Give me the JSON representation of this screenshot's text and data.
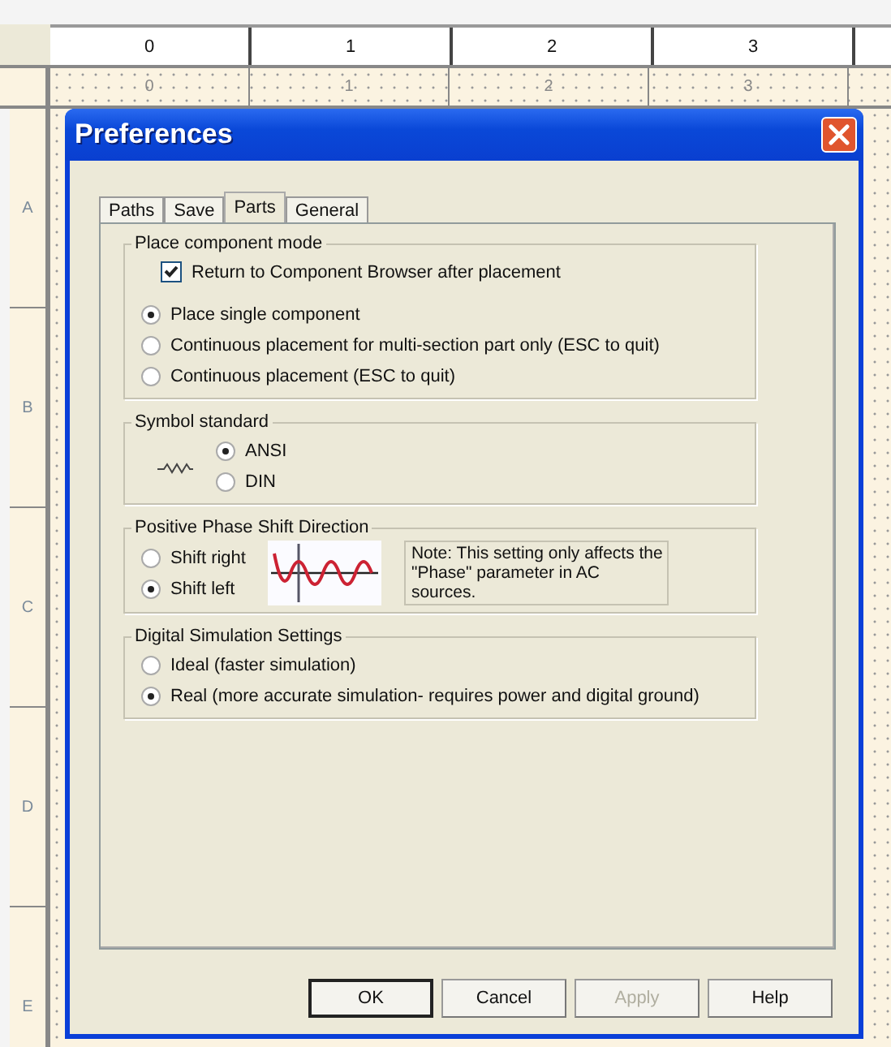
{
  "top_ruler": {
    "labels": [
      "0",
      "1",
      "2",
      "3"
    ]
  },
  "sheet_border": {
    "column_labels": [
      "0",
      "1",
      "2",
      "3"
    ],
    "row_labels": [
      "A",
      "B",
      "C",
      "D",
      "E"
    ]
  },
  "dialog": {
    "title": "Preferences",
    "tabs": [
      {
        "label": "Paths",
        "selected": false
      },
      {
        "label": "Save",
        "selected": false
      },
      {
        "label": "Parts",
        "selected": true
      },
      {
        "label": "General",
        "selected": false
      }
    ],
    "groups": [
      {
        "kind": "plain",
        "title": "Place component mode",
        "checkbox": {
          "label": "Return to Component Browser after placement",
          "checked": true
        },
        "radios": [
          {
            "label": "Place single component",
            "selected": true
          },
          {
            "label": "Continuous placement for multi-section part only (ESC to quit)",
            "selected": false
          },
          {
            "label": "Continuous placement (ESC to quit)",
            "selected": false
          }
        ]
      },
      {
        "kind": "symbol",
        "title": "Symbol standard",
        "radios": [
          {
            "label": "ANSI",
            "selected": true
          },
          {
            "label": "DIN",
            "selected": false
          }
        ]
      },
      {
        "kind": "phase",
        "title": "Positive Phase Shift Direction",
        "radios": [
          {
            "label": "Shift right",
            "selected": false
          },
          {
            "label": "Shift left",
            "selected": true
          }
        ],
        "note": "Note: This setting only affects the \"Phase\" parameter in AC sources."
      },
      {
        "kind": "plain",
        "title": "Digital Simulation Settings",
        "radios": [
          {
            "label": "Ideal (faster simulation)",
            "selected": false
          },
          {
            "label": "Real (more accurate simulation- requires power and digital ground)",
            "selected": true
          }
        ]
      }
    ],
    "buttons": [
      {
        "label": "OK",
        "default": true,
        "disabled": false
      },
      {
        "label": "Cancel",
        "default": false,
        "disabled": false
      },
      {
        "label": "Apply",
        "default": false,
        "disabled": true
      },
      {
        "label": "Help",
        "default": false,
        "disabled": false
      }
    ]
  }
}
